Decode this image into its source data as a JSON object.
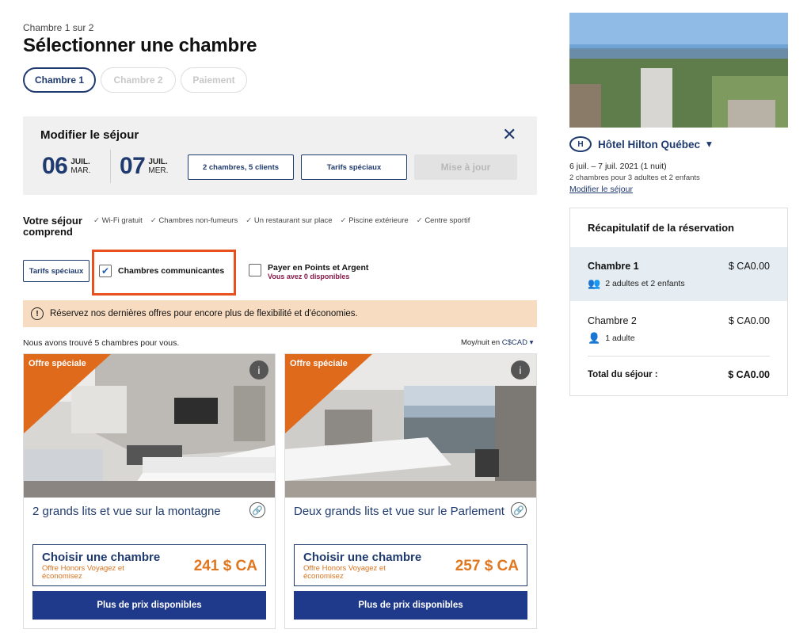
{
  "header": {
    "step_count": "Chambre 1 sur 2",
    "title": "Sélectionner une chambre",
    "steps": [
      "Chambre 1",
      "Chambre 2",
      "Paiement"
    ]
  },
  "modify": {
    "title": "Modifier le séjour",
    "close": "✕",
    "checkin": {
      "day": "06",
      "month": "JUIL.",
      "weekday": "MAR."
    },
    "checkout": {
      "day": "07",
      "month": "JUIL.",
      "weekday": "MER."
    },
    "rooms_guests": "2 chambres, 5 clients",
    "special_rates": "Tarifs spéciaux",
    "update": "Mise à jour"
  },
  "stay": {
    "label": "Votre séjour comprend",
    "amenities": [
      "Wi-Fi gratuit",
      "Chambres non-fumeurs",
      "Un restaurant sur place",
      "Piscine extérieure",
      "Centre sportif"
    ]
  },
  "filters": {
    "special_rates": "Tarifs spéciaux",
    "connecting": "Chambres communicantes",
    "connecting_checked": true,
    "points": "Payer en Points et Argent",
    "points_sub": "Vous avez 0 disponibles"
  },
  "notice": "Réservez nos dernières offres pour encore plus de flexibilité et d'économies.",
  "results": {
    "found": "Nous avons trouvé 5 chambres pour vous.",
    "avg_label": "Moy/nuit en",
    "currency": "C$CAD"
  },
  "rooms": [
    {
      "badge": "Offre spéciale",
      "name": "2 grands lits et vue sur la montagne",
      "choose": "Choisir une chambre",
      "offer": "Offre Honors Voyagez et économisez",
      "price": "241 $ CA",
      "more": "Plus de prix disponibles"
    },
    {
      "badge": "Offre spéciale",
      "name": "Deux grands lits et vue sur le Parlement",
      "choose": "Choisir une chambre",
      "offer": "Offre Honors Voyagez et économisez",
      "price": "257 $ CA",
      "more": "Plus de prix disponibles"
    }
  ],
  "hotel": {
    "name": "Hôtel Hilton Québec",
    "dates": "6 juil. – 7 juil. 2021 (1 nuit)",
    "guests": "2 chambres pour 3 adultes et 2 enfants",
    "modify_link": "Modifier le séjour"
  },
  "summary": {
    "title": "Récapitulatif de la réservation",
    "rooms": [
      {
        "name": "Chambre 1",
        "price": "$ CA0.00",
        "guests": "2 adultes et 2 enfants"
      },
      {
        "name": "Chambre 2",
        "price": "$ CA0.00",
        "guests": "1 adulte"
      }
    ],
    "total_label": "Total du séjour :",
    "total": "$ CA0.00"
  },
  "colors": {
    "brand": "#1f3a6e",
    "accent": "#e06a1b",
    "highlight": "#e8501e"
  }
}
